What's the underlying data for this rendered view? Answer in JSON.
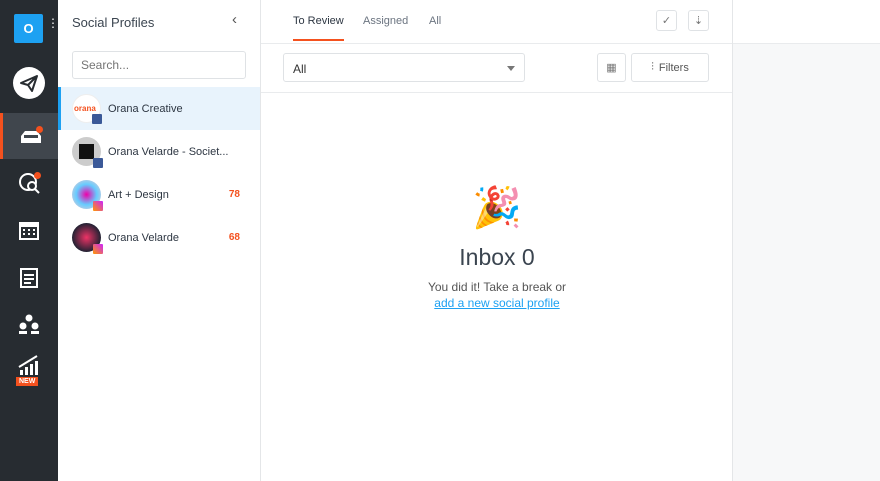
{
  "rail": {
    "logo_letter": "O",
    "new_badge": "NEW",
    "accent": "#f4511e"
  },
  "panel": {
    "title": "Social Profiles",
    "search_placeholder": "Search...",
    "profiles": [
      {
        "name": "Orana Creative",
        "network": "facebook",
        "count": null
      },
      {
        "name": "Orana Velarde - Societ...",
        "network": "facebook",
        "count": null
      },
      {
        "name": "Art + Design",
        "network": "instagram",
        "count": "78"
      },
      {
        "name": "Orana Velarde",
        "network": "instagram",
        "count": "68"
      }
    ]
  },
  "main": {
    "tabs": [
      "To Review",
      "Assigned",
      "All"
    ],
    "filter_value": "All",
    "filters_label": "Filters",
    "empty": {
      "emoji": "🎉",
      "title": "Inbox 0",
      "subtitle": "You did it! Take a break or",
      "link": "add a new social profile"
    }
  }
}
